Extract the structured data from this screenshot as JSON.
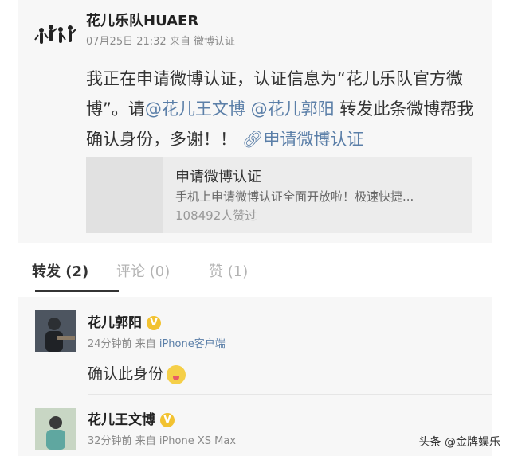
{
  "post": {
    "author": "花儿乐队HUAER",
    "meta": "07月25日 21:32  来自 微博认证",
    "content_part1": "我正在申请微博认证，认证信息为“花儿乐队官方微博”。请",
    "mention1": "@花儿王文博",
    "mention2": "@花儿郭阳",
    "content_part2": " 转发此条微博帮我确认身份，多谢！！",
    "link_icon": "link-icon",
    "link_label": "申请微博认证",
    "card": {
      "title": "申请微博认证",
      "description": "手机上申请微博认证全面开放啦！极速快捷...",
      "likes": "108492人赞过"
    }
  },
  "tabs": [
    {
      "label": "转发 (2)"
    },
    {
      "label": "评论 (0)"
    },
    {
      "label": "赞 (1)"
    }
  ],
  "replies": [
    {
      "name": "花儿郭阳",
      "time": "24分钟前",
      "from": "来自",
      "source": "iPhone客户端",
      "text": "确认此身份"
    },
    {
      "name": "花儿王文博",
      "time": "32分钟前",
      "from": "来自",
      "source": "iPhone XS Max",
      "text": ""
    }
  ],
  "watermark": "头条 @金牌娱乐",
  "colors": {
    "link": "#5b7fa8",
    "badge": "#f2c230",
    "background": "#f7f7f7"
  }
}
